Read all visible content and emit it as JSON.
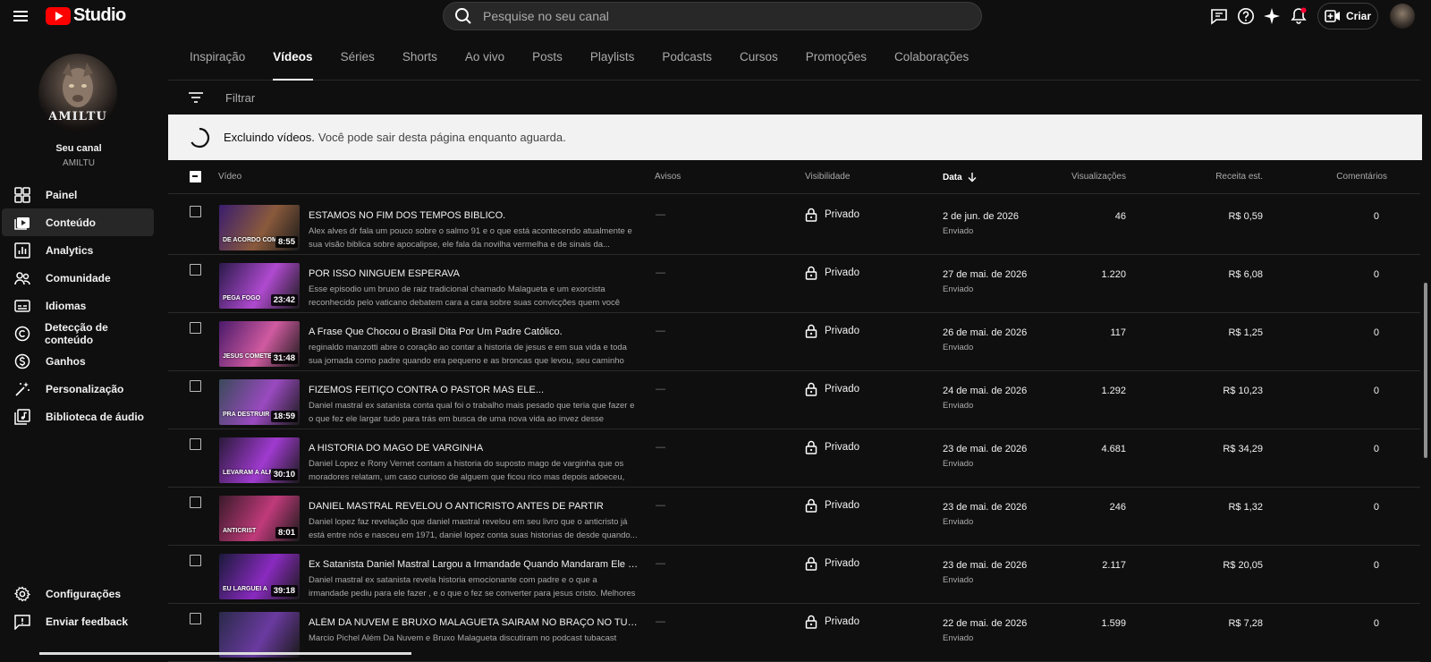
{
  "topbar": {
    "logo_text": "Studio",
    "search_placeholder": "Pesquise no seu canal",
    "create_label": "Criar"
  },
  "channel": {
    "label": "Seu canal",
    "name": "AMILTU",
    "avatar_text": "AMILTU"
  },
  "sidebar": {
    "items": [
      {
        "label": "Painel",
        "icon": "dashboard-icon",
        "active": false
      },
      {
        "label": "Conteúdo",
        "icon": "content-icon",
        "active": true
      },
      {
        "label": "Analytics",
        "icon": "analytics-icon",
        "active": false
      },
      {
        "label": "Comunidade",
        "icon": "community-icon",
        "active": false
      },
      {
        "label": "Idiomas",
        "icon": "subtitles-icon",
        "active": false
      },
      {
        "label": "Detecção de conteúdo",
        "icon": "copyright-icon",
        "active": false
      },
      {
        "label": "Ganhos",
        "icon": "earn-icon",
        "active": false
      },
      {
        "label": "Personalização",
        "icon": "customization-icon",
        "active": false
      },
      {
        "label": "Biblioteca de áudio",
        "icon": "audio-library-icon",
        "active": false
      }
    ],
    "bottom": [
      {
        "label": "Configurações",
        "icon": "settings-icon"
      },
      {
        "label": "Enviar feedback",
        "icon": "feedback-icon"
      }
    ]
  },
  "tabs": [
    "Inspiração",
    "Vídeos",
    "Séries",
    "Shorts",
    "Ao vivo",
    "Posts",
    "Playlists",
    "Podcasts",
    "Cursos",
    "Promoções",
    "Colaborações"
  ],
  "active_tab": "Vídeos",
  "filter": {
    "placeholder": "Filtrar"
  },
  "banner": {
    "bold": "Excluindo vídeos.",
    "text": "Você pode sair desta página enquanto aguarda."
  },
  "table": {
    "headers": {
      "video": "Vídeo",
      "avisos": "Avisos",
      "visibilidade": "Visibilidade",
      "data": "Data",
      "views": "Visualizações",
      "revenue": "Receita est.",
      "comments": "Comentários"
    },
    "rows": [
      {
        "title": "ESTAMOS NO FIM DOS TEMPOS BIBLICO.",
        "desc": "Alex alves dr fala um pouco sobre o salmo 91 e o que está acontecendo atualmente e sua visão biblica sobre apocalipse, ele fala da novilha vermelha e de sinais da...",
        "duration": "8:55",
        "avisos": "—",
        "visibility": "Privado",
        "date": "2 de jun. de 2026",
        "status": "Enviado",
        "views": "46",
        "revenue": "R$ 0,59",
        "comments": "0",
        "thumb_caption": "DE ACORDO COM",
        "colors": [
          "#3a1d6e",
          "#8a5a3c"
        ]
      },
      {
        "title": "POR ISSO NINGUEM ESPERAVA",
        "desc": "Esse episodio um bruxo de raiz tradicional chamado Malagueta e um exorcista reconhecido pelo vaticano debatem cara a cara sobre suas convicções quem você ach...",
        "duration": "23:42",
        "avisos": "—",
        "visibility": "Privado",
        "date": "27 de mai. de 2026",
        "status": "Enviado",
        "views": "1.220",
        "revenue": "R$ 6,08",
        "comments": "0",
        "thumb_caption": "PEGA FOGO",
        "colors": [
          "#2a1a4a",
          "#b04ad0"
        ]
      },
      {
        "title": "A Frase Que Chocou o Brasil Dita Por Um Padre Católico.",
        "desc": "reginaldo manzotti abre o coração ao contar a historia de jesus e em sua vida e toda sua jornada como padre quando era pequeno e as broncas que levou, seu caminho nos...",
        "duration": "31:48",
        "avisos": "—",
        "visibility": "Privado",
        "date": "26 de mai. de 2026",
        "status": "Enviado",
        "views": "117",
        "revenue": "R$ 1,25",
        "comments": "0",
        "thumb_caption": "JESUS COMETEU",
        "colors": [
          "#4a1a6a",
          "#d05aa0"
        ]
      },
      {
        "title": "FIZEMOS FEITIÇO CONTRA O PASTOR MAS ELE...",
        "desc": "Daniel mastral ex satanista conta qual foi o trabalho mais pesado que teria que fazer e o que fez ele largar tudo para trás em busca de uma nova vida ao invez desse trabalho....",
        "duration": "18:59",
        "avisos": "—",
        "visibility": "Privado",
        "date": "24 de mai. de 2026",
        "status": "Enviado",
        "views": "1.292",
        "revenue": "R$ 10,23",
        "comments": "0",
        "thumb_caption": "PRA DESTRUIR",
        "colors": [
          "#3a4a5a",
          "#9a4ac0"
        ]
      },
      {
        "title": "A HISTORIA DO MAGO DE VARGINHA",
        "desc": "Daniel Lopez e Rony Vernet contam a historia do suposto mago de varginha que os moradores relatam, um caso curioso de alguem que ficou rico mas depois adoeceu, e...",
        "duration": "30:10",
        "avisos": "—",
        "visibility": "Privado",
        "date": "23 de mai. de 2026",
        "status": "Enviado",
        "views": "4.681",
        "revenue": "R$ 34,29",
        "comments": "0",
        "thumb_caption": "LEVARAM A ALMA",
        "colors": [
          "#2a1a3a",
          "#a03ad0"
        ]
      },
      {
        "title": "DANIEL MASTRAL REVELOU O ANTICRISTO ANTES DE PARTIR",
        "desc": "Daniel lopez faz revelação que daniel mastral revelou em seu livro que o anticristo já está entre nós e nasceu em 1971, daniel lopez conta suas historias de desde quando...",
        "duration": "8:01",
        "avisos": "—",
        "visibility": "Privado",
        "date": "23 de mai. de 2026",
        "status": "Enviado",
        "views": "246",
        "revenue": "R$ 1,32",
        "comments": "0",
        "thumb_caption": "ANTICRIST",
        "colors": [
          "#3a1a2a",
          "#c03a7a"
        ]
      },
      {
        "title": "Ex Satanista Daniel Mastral Largou a Irmandade Quando Mandaram Ele Fazer...",
        "desc": "Daniel mastral ex satanista revela historia emocionante com padre e o que a irmandade pediu para ele fazer , e o que o fez se converter para jesus cristo. Melhores cortes com...",
        "duration": "39:18",
        "avisos": "—",
        "visibility": "Privado",
        "date": "23 de mai. de 2026",
        "status": "Enviado",
        "views": "2.117",
        "revenue": "R$ 20,05",
        "comments": "0",
        "thumb_caption": "EU LARGUEI A",
        "colors": [
          "#1a1a3a",
          "#8a2ac0"
        ]
      },
      {
        "title": "ALÉM DA NUVEM E BRUXO MALAGUETA SAIRAM NO BRAÇO NO TUBACAST",
        "desc": "Marcio Pichel Além Da Nuvem e Bruxo Malagueta discutiram no podcast tubacast",
        "duration": "",
        "avisos": "—",
        "visibility": "Privado",
        "date": "22 de mai. de 2026",
        "status": "Enviado",
        "views": "1.599",
        "revenue": "R$ 7,28",
        "comments": "0",
        "thumb_caption": "",
        "colors": [
          "#2a2a4a",
          "#6a3aa0"
        ]
      }
    ]
  }
}
